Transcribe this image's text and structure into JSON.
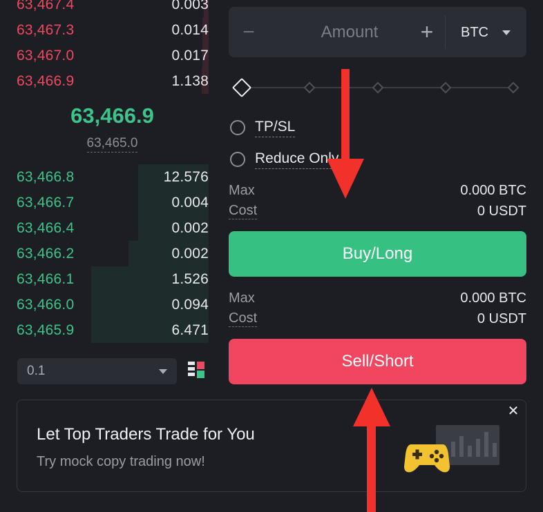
{
  "order_book": {
    "asks": [
      {
        "price": "63,467.4",
        "qty": "0.003",
        "depth": 0.04
      },
      {
        "price": "63,467.3",
        "qty": "0.014",
        "depth": 0.05
      },
      {
        "price": "63,467.0",
        "qty": "0.017",
        "depth": 0.05
      },
      {
        "price": "63,466.9",
        "qty": "1.138",
        "depth": 0.06
      }
    ],
    "last_price": "63,466.9",
    "mark_price": "63,465.0",
    "bids": [
      {
        "price": "63,466.8",
        "qty": "12.576",
        "depth": 0.6
      },
      {
        "price": "63,466.7",
        "qty": "0.004",
        "depth": 0.6
      },
      {
        "price": "63,466.4",
        "qty": "0.002",
        "depth": 0.6
      },
      {
        "price": "63,466.2",
        "qty": "0.002",
        "depth": 0.68
      },
      {
        "price": "63,466.1",
        "qty": "1.526",
        "depth": 1.0
      },
      {
        "price": "63,466.0",
        "qty": "0.094",
        "depth": 1.0
      },
      {
        "price": "63,465.9",
        "qty": "6.471",
        "depth": 1.0
      }
    ],
    "precision": "0.1"
  },
  "order_form": {
    "amount_placeholder": "Amount",
    "amount_minus": "−",
    "amount_plus": "+",
    "unit": "BTC",
    "slider_percent": 0,
    "tpsl_label": "TP/SL",
    "reduce_only_label": "Reduce Only",
    "buy_info": {
      "max_label": "Max",
      "max_value": "0.000 BTC",
      "cost_label": "Cost",
      "cost_value": "0 USDT"
    },
    "buy_label": "Buy/Long",
    "sell_info": {
      "max_label": "Max",
      "max_value": "0.000 BTC",
      "cost_label": "Cost",
      "cost_value": "0 USDT"
    },
    "sell_label": "Sell/Short"
  },
  "promo": {
    "title": "Let Top Traders Trade for You",
    "subtitle": "Try mock copy trading now!",
    "close": "✕",
    "image_icon": "gamepad-icon"
  },
  "colors": {
    "ask": "#f0485f",
    "bid": "#3cc48b",
    "buy": "#36c183",
    "sell": "#f2455f",
    "annotation_arrow": "#f2312b"
  }
}
